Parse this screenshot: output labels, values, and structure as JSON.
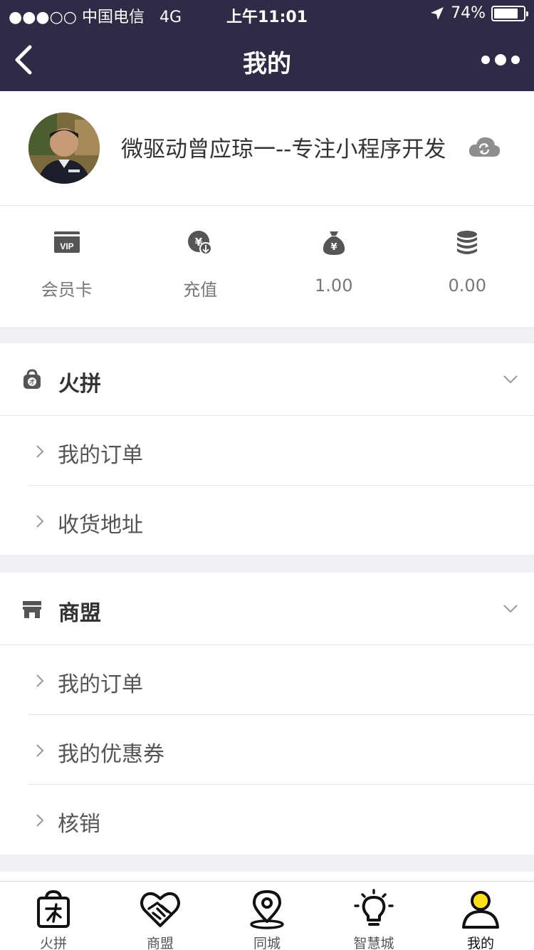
{
  "status_bar": {
    "carrier": "●●●○○ 中国电信",
    "network": "4G",
    "time": "上午11:01",
    "battery": "74%",
    "battery_level": 0.74
  },
  "navbar": {
    "title": "我的"
  },
  "profile": {
    "nickname": "微驱动曾应琼一--专注小程序开发"
  },
  "stats": [
    {
      "label": "会员卡",
      "icon": "vip-card-icon"
    },
    {
      "label": "充值",
      "icon": "recharge-icon"
    },
    {
      "label": "1.00",
      "icon": "money-bag-icon"
    },
    {
      "label": "0.00",
      "icon": "coins-icon"
    }
  ],
  "sections": [
    {
      "title": "火拼",
      "icon": "group-buy-bag-icon",
      "items": [
        {
          "label": "我的订单"
        },
        {
          "label": "收货地址"
        }
      ]
    },
    {
      "title": "商盟",
      "icon": "store-icon",
      "items": [
        {
          "label": "我的订单"
        },
        {
          "label": "我的优惠券"
        },
        {
          "label": "核销"
        }
      ]
    }
  ],
  "tabbar": [
    {
      "label": "火拼",
      "icon": "shopping-bag-icon"
    },
    {
      "label": "商盟",
      "icon": "handshake-heart-icon"
    },
    {
      "label": "同城",
      "icon": "location-pin-icon"
    },
    {
      "label": "智慧城",
      "icon": "lightbulb-icon"
    },
    {
      "label": "我的",
      "icon": "user-icon",
      "active": true
    }
  ],
  "colors": {
    "header_bg": "#2f2a45",
    "page_bg": "#efeff4",
    "icon_gray": "#555555",
    "active_user_yellow": "#ffe01b"
  }
}
